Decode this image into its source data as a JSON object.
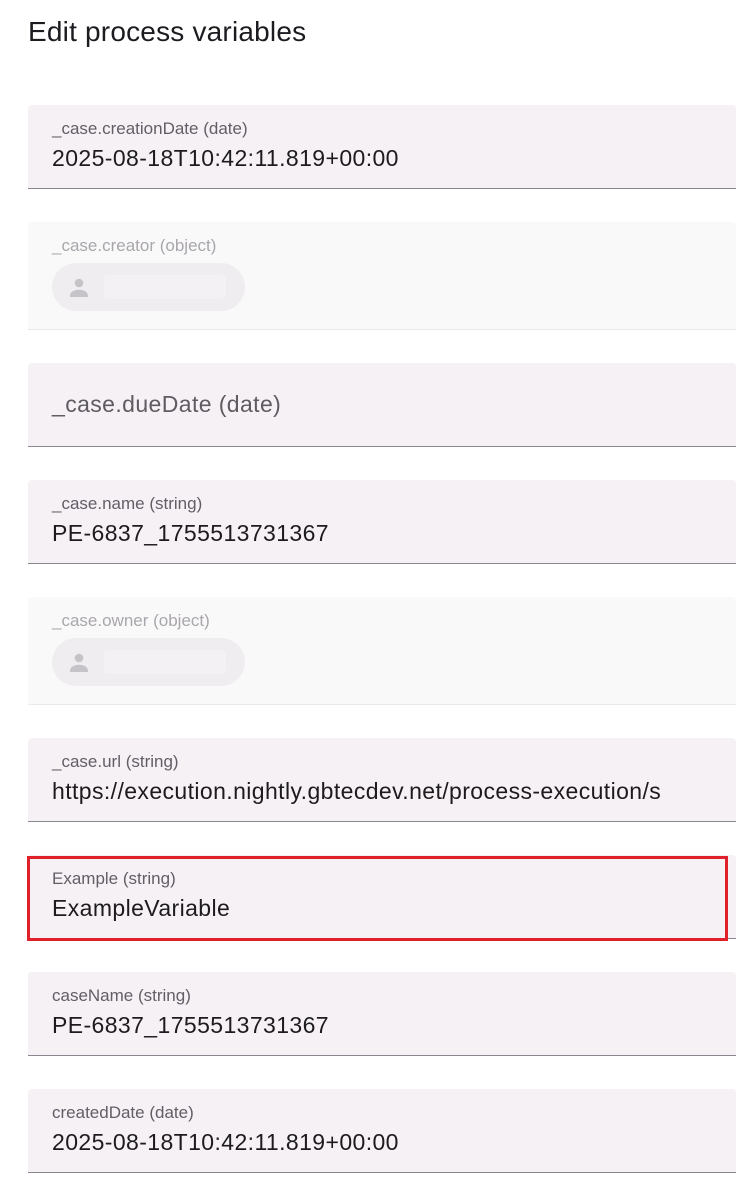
{
  "page": {
    "title": "Edit process variables"
  },
  "fields": [
    {
      "label": "_case.creationDate (date)",
      "value": "2025-08-18T10:42:11.819+00:00"
    },
    {
      "label": "_case.creator (object)",
      "value": ""
    },
    {
      "label": "",
      "placeholder": "_case.dueDate (date)"
    },
    {
      "label": "_case.name (string)",
      "value": "PE-6837_1755513731367"
    },
    {
      "label": "_case.owner (object)",
      "value": ""
    },
    {
      "label": "_case.url (string)",
      "value": "https://execution.nightly.gbtecdev.net/process-execution/s"
    },
    {
      "label": "Example (string)",
      "value": "ExampleVariable"
    },
    {
      "label": "caseName (string)",
      "value": "PE-6837_1755513731367"
    },
    {
      "label": "createdDate (date)",
      "value": "2025-08-18T10:42:11.819+00:00"
    }
  ],
  "colors": {
    "highlight": "#e0202a",
    "field_background": "#f5f1f4"
  },
  "icons": {
    "chip_icon": "person-icon"
  }
}
